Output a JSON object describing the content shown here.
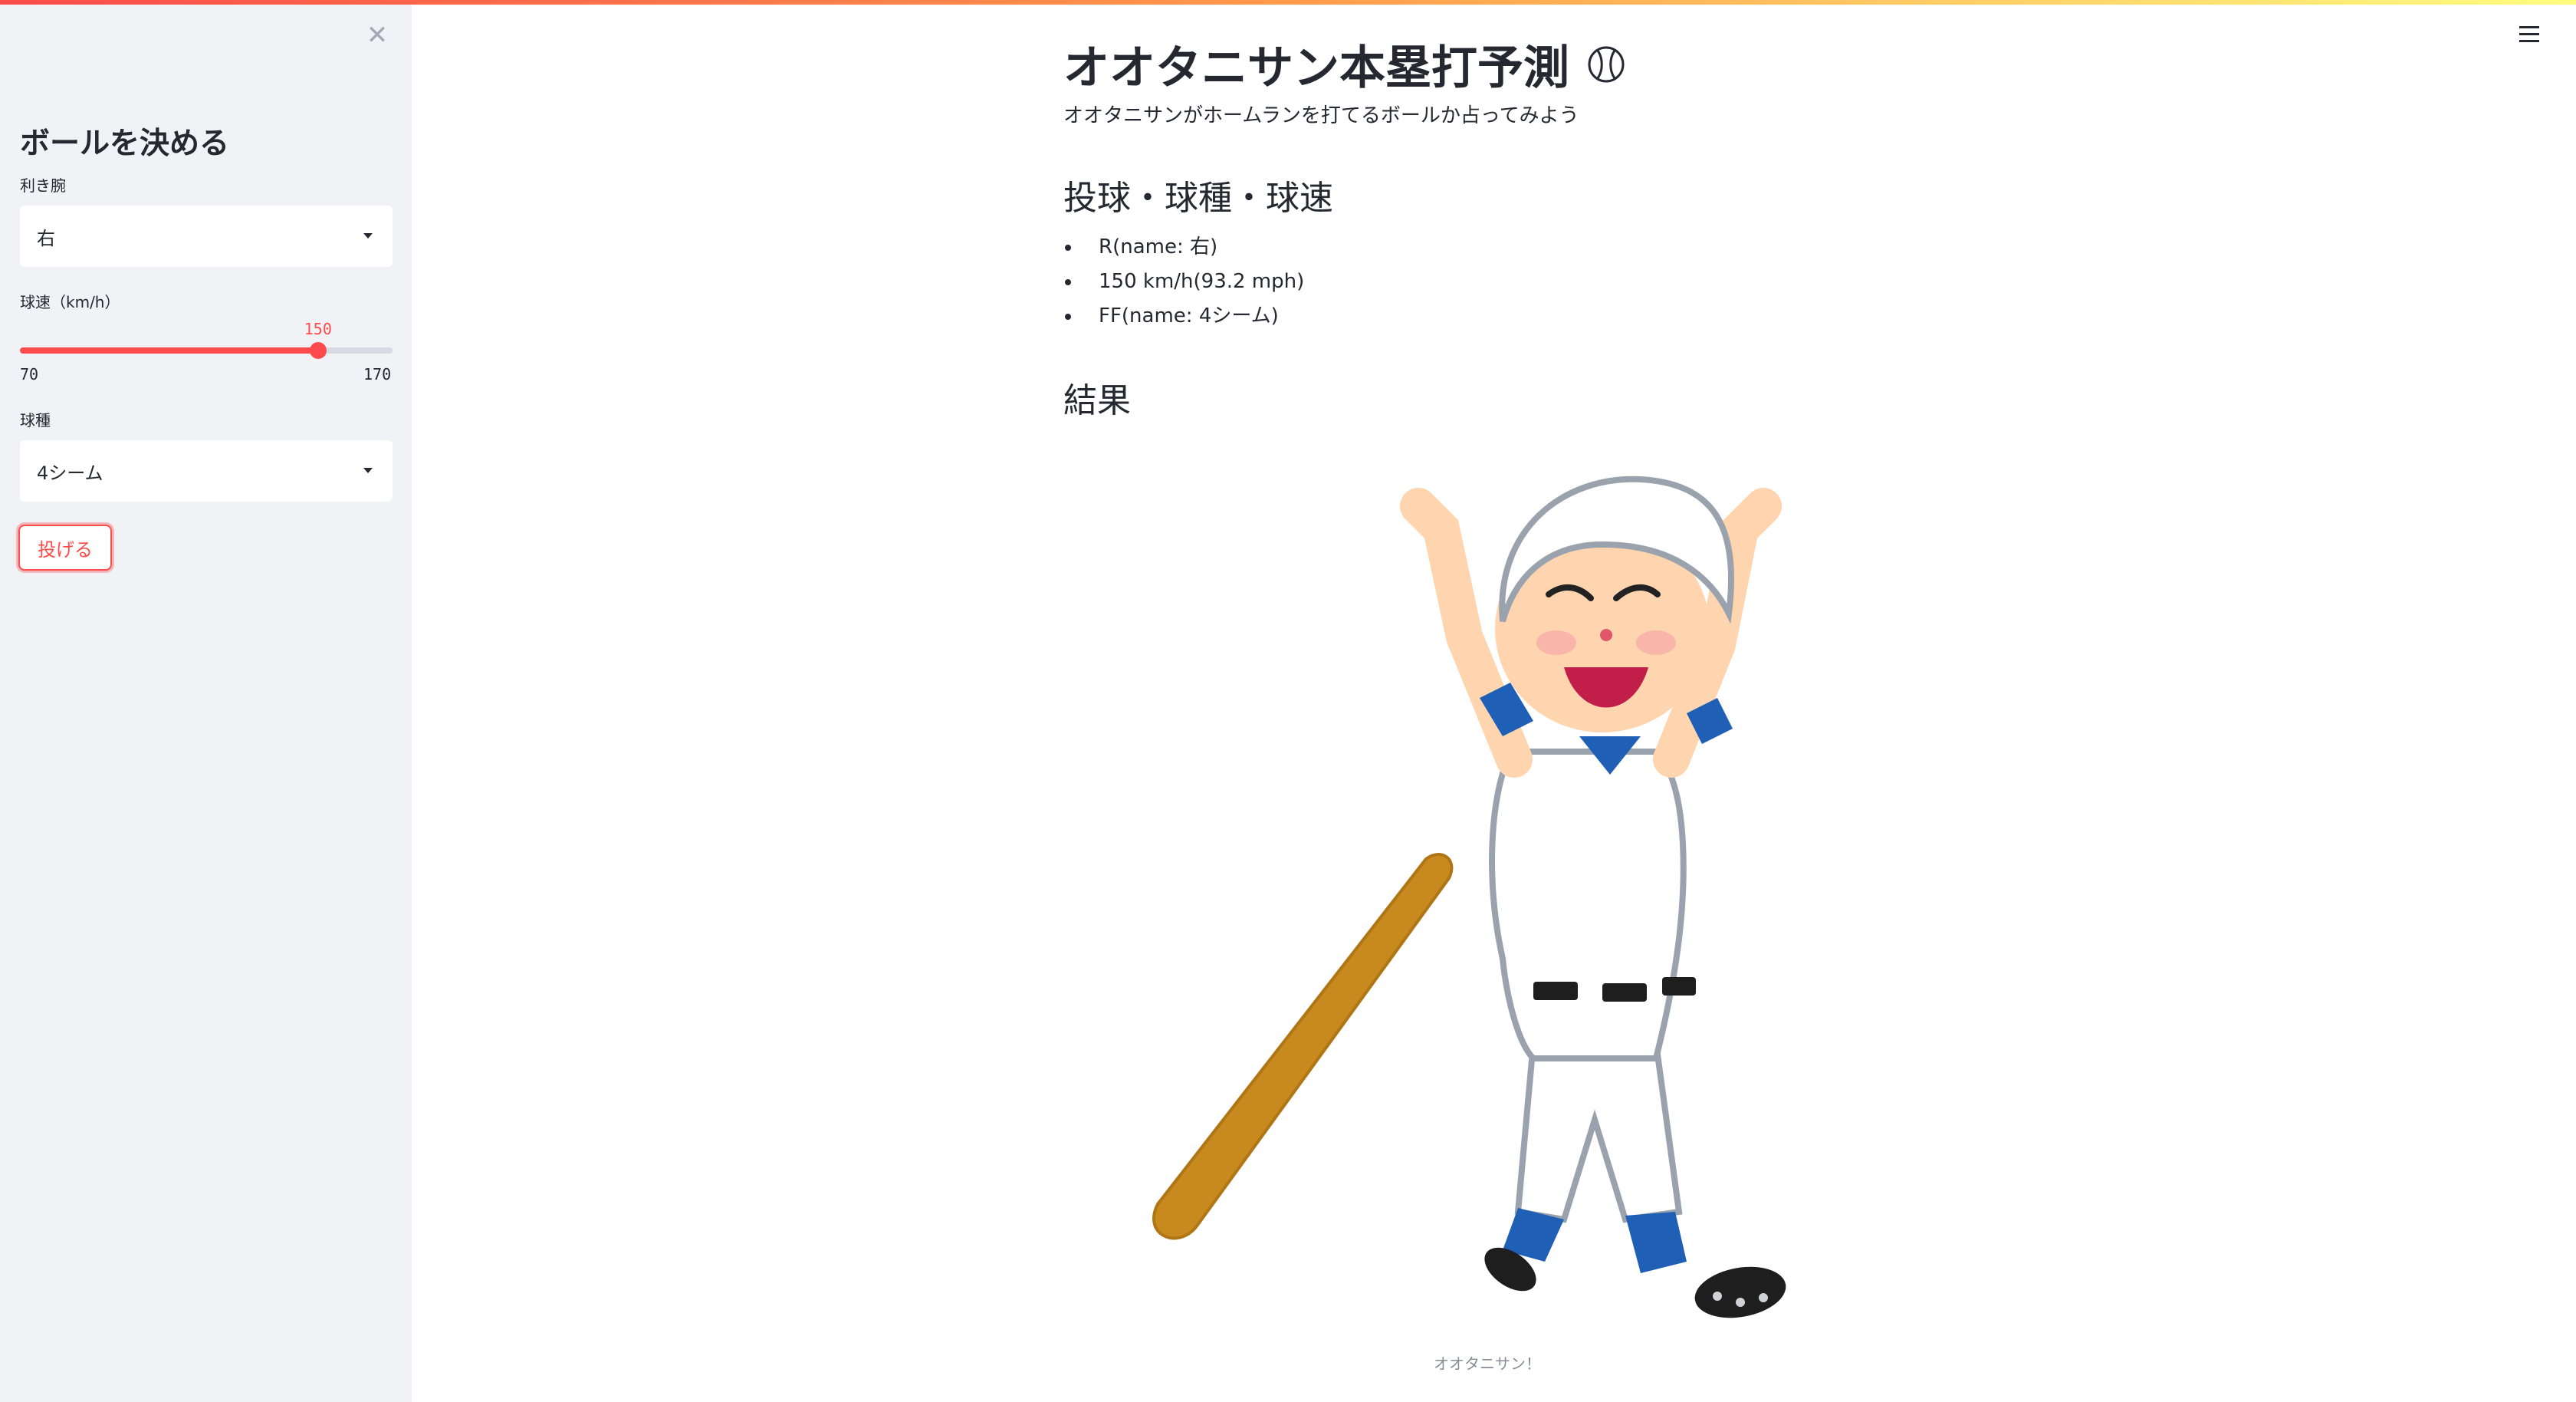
{
  "sidebar": {
    "close_icon": "close-icon",
    "title": "ボールを決める",
    "handedness": {
      "label": "利き腕",
      "value": "右"
    },
    "speed": {
      "label": "球速（km/h）",
      "value": "150",
      "min": "70",
      "max": "170",
      "min_num": 70,
      "max_num": 170,
      "value_num": 150
    },
    "pitch_type": {
      "label": "球種",
      "value": "4シーム"
    },
    "throw_button": "投げる"
  },
  "main": {
    "title": "オオタニサン本塁打予測",
    "title_icon": "baseball-icon",
    "subtitle": "オオタニサンがホームランを打てるボールか占ってみよう",
    "section_pitch": "投球・球種・球速",
    "pitch_items": [
      "R(name: 右)",
      "150 km/h(93.2 mph)",
      "FF(name: 4シーム)"
    ],
    "section_result": "結果",
    "result_caption": "オオタニサン！"
  },
  "menu_icon": "hamburger-menu-icon",
  "colors": {
    "accent": "#ff4b4b",
    "sidebar_bg": "#f0f2f6",
    "text": "#262730"
  }
}
